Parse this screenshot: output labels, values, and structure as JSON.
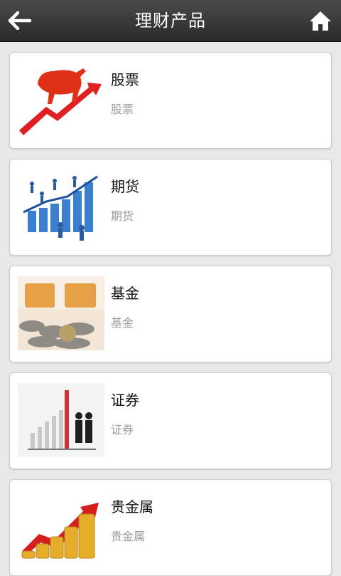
{
  "header": {
    "title": "理财产品",
    "back_icon": "back-arrow-icon",
    "home_icon": "home-icon"
  },
  "items": [
    {
      "title": "股票",
      "subtitle": "股票",
      "image": "stock-bull-chart-image"
    },
    {
      "title": "期货",
      "subtitle": "期货",
      "image": "futures-bar-chart-people-image"
    },
    {
      "title": "基金",
      "subtitle": "基金",
      "image": "fund-coins-image"
    },
    {
      "title": "证券",
      "subtitle": "证券",
      "image": "securities-handshake-chart-image"
    },
    {
      "title": "贵金属",
      "subtitle": "贵金属",
      "image": "precious-metal-gold-coins-image"
    }
  ]
}
